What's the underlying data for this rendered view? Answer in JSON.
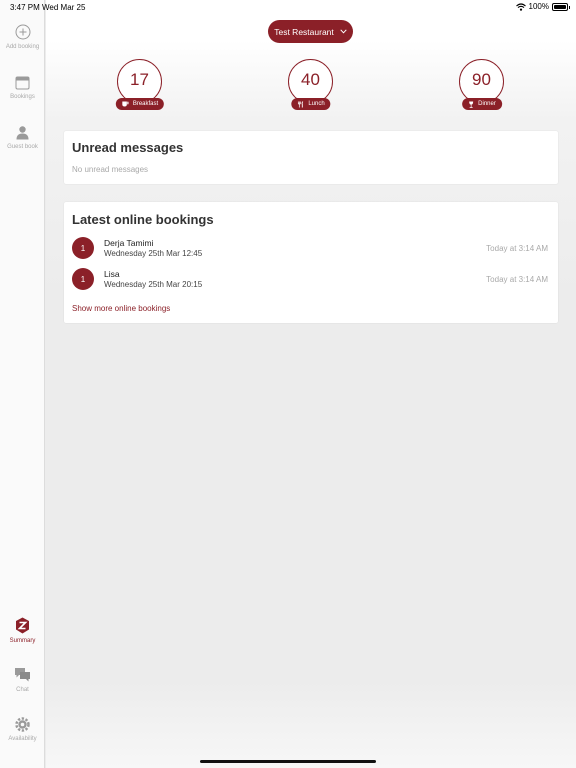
{
  "status_bar": {
    "time": "3:47 PM",
    "date": "Wed Mar 25",
    "battery": "100%"
  },
  "sidebar": {
    "top_items": [
      {
        "label": "Add booking",
        "icon": "add-circle-icon"
      },
      {
        "label": "Bookings",
        "icon": "calendar-icon"
      },
      {
        "label": "Guest book",
        "icon": "person-icon"
      }
    ],
    "bottom_items": [
      {
        "label": "Summary",
        "icon": "summary-logo-icon",
        "active": true
      },
      {
        "label": "Chat",
        "icon": "chat-icon"
      },
      {
        "label": "Availability",
        "icon": "gear-icon"
      }
    ]
  },
  "header": {
    "restaurant": "Test Restaurant"
  },
  "meals": [
    {
      "count": "17",
      "label": "Breakfast",
      "icon": "cup-icon"
    },
    {
      "count": "40",
      "label": "Lunch",
      "icon": "fork-knife-icon"
    },
    {
      "count": "90",
      "label": "Dinner",
      "icon": "wine-glass-icon"
    }
  ],
  "unread": {
    "title": "Unread messages",
    "empty_text": "No unread messages"
  },
  "latest": {
    "title": "Latest online bookings",
    "bookings": [
      {
        "guests": "1",
        "name": "Derja Tamimi",
        "datetime": "Wednesday 25th Mar 12:45",
        "created": "Today at 3:14 AM"
      },
      {
        "guests": "1",
        "name": "Lisa",
        "datetime": "Wednesday 25th Mar 20:15",
        "created": "Today at 3:14 AM"
      }
    ],
    "show_more": "Show more online bookings"
  },
  "colors": {
    "accent": "#8b2028",
    "muted": "#a9a9a9",
    "background": "#ececec"
  }
}
